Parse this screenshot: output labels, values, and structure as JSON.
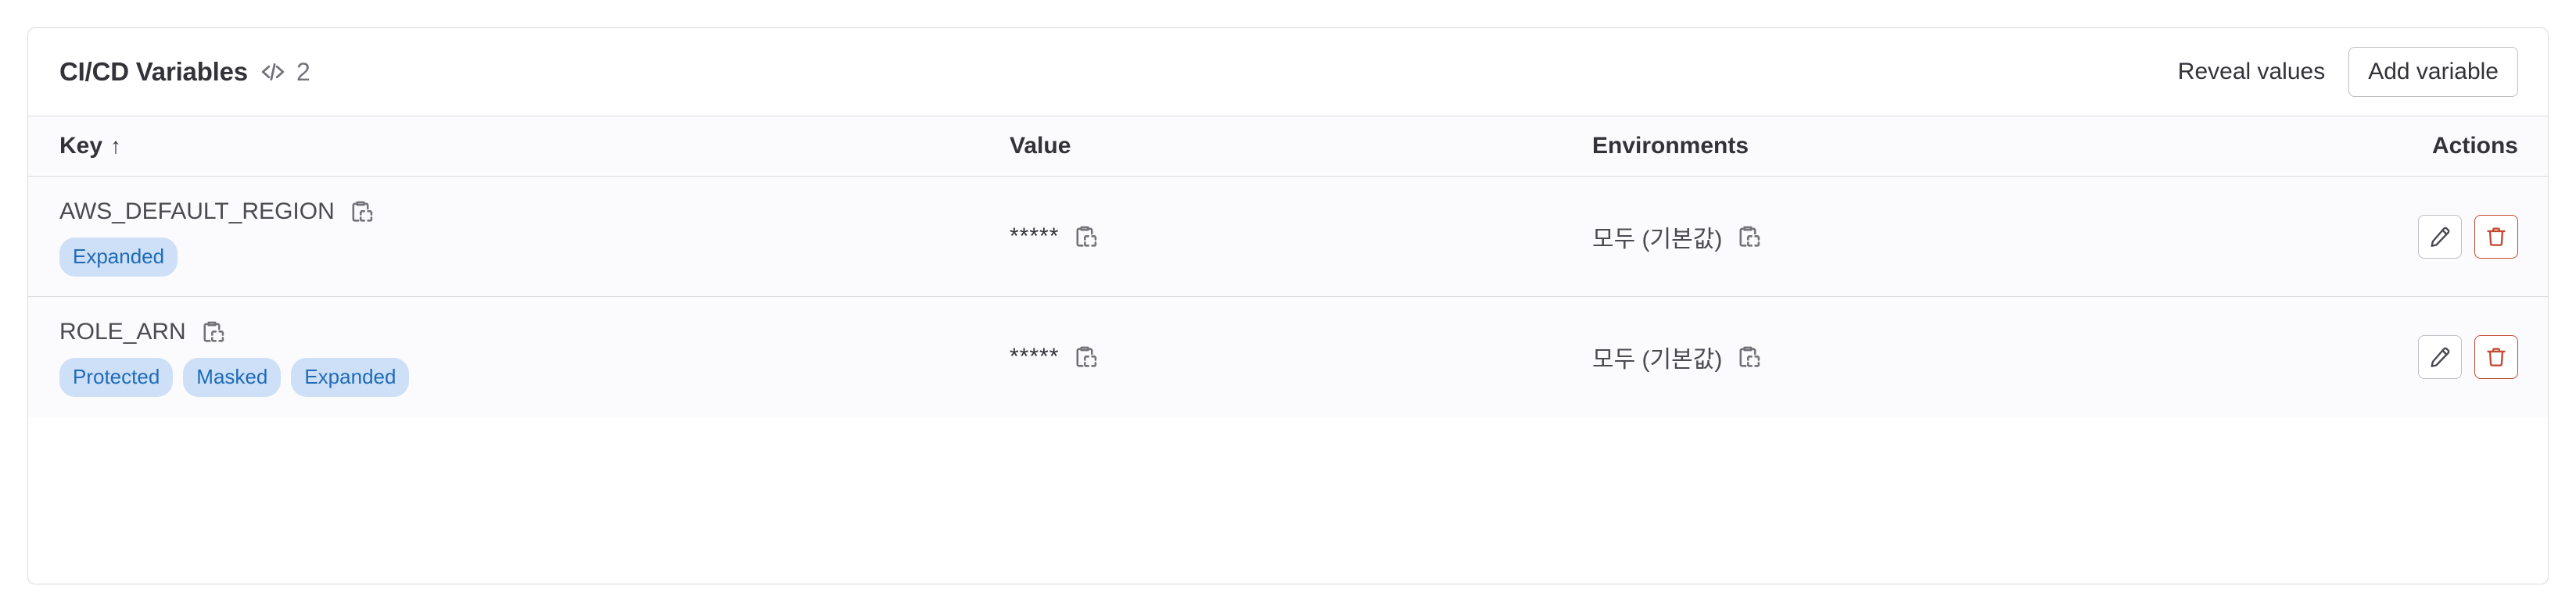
{
  "card": {
    "title": "CI/CD Variables",
    "code_icon": "code-icon",
    "count": "2",
    "reveal_label": "Reveal values",
    "add_label": "Add variable"
  },
  "table": {
    "headers": {
      "key": "Key",
      "sort_indicator": "↑",
      "value": "Value",
      "environments": "Environments",
      "actions": "Actions"
    },
    "rows": [
      {
        "key": "AWS_DEFAULT_REGION",
        "badges": [
          "Expanded"
        ],
        "value": "*****",
        "environment": "모두 (기본값)"
      },
      {
        "key": "ROLE_ARN",
        "badges": [
          "Protected",
          "Masked",
          "Expanded"
        ],
        "value": "*****",
        "environment": "모두 (기본값)"
      }
    ]
  },
  "colors": {
    "badge_bg": "#cde0f7",
    "badge_text": "#1f6bb8",
    "delete_accent": "#c24b32",
    "border": "#dcdcde",
    "row_bg": "#fbfafd"
  }
}
